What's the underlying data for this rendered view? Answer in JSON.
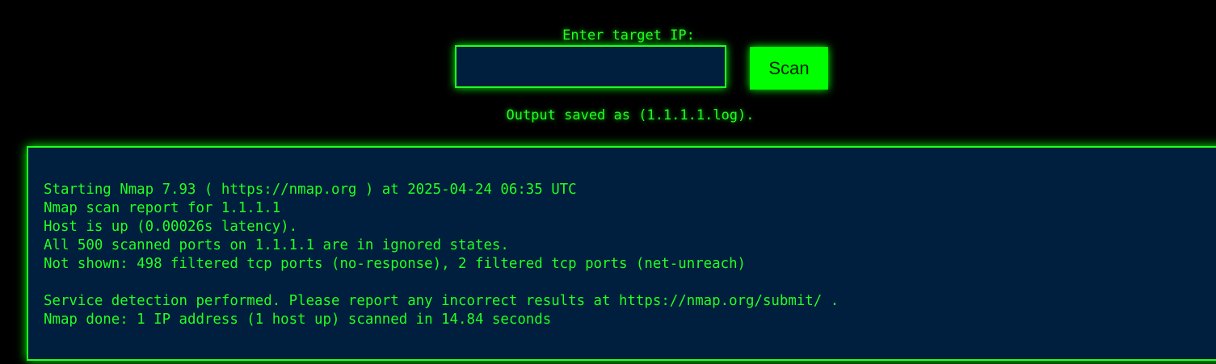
{
  "form": {
    "label": "Enter target IP:",
    "ip_value": "",
    "scan_label": "Scan"
  },
  "status": {
    "saved_message": "Output saved as (1.1.1.1.log)."
  },
  "output": {
    "lines": [
      "Starting Nmap 7.93 ( https://nmap.org ) at 2025-04-24 06:35 UTC",
      "Nmap scan report for 1.1.1.1",
      "Host is up (0.00026s latency).",
      "All 500 scanned ports on 1.1.1.1 are in ignored states.",
      "Not shown: 498 filtered tcp ports (no-response), 2 filtered tcp ports (net-unreach)",
      "",
      "Service detection performed. Please report any incorrect results at https://nmap.org/submit/ .",
      "Nmap done: 1 IP address (1 host up) scanned in 14.84 seconds"
    ]
  },
  "colors": {
    "accent": "#22ff22",
    "button_bg": "#00ff00",
    "panel_bg": "#001e3d",
    "page_bg": "#000000"
  }
}
